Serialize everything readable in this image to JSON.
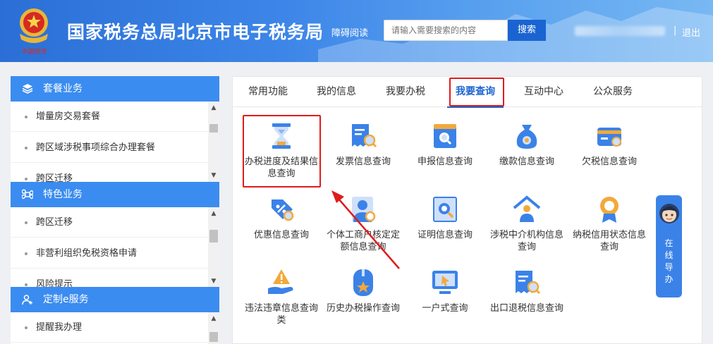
{
  "header": {
    "title": "国家税务总局北京市电子税务局",
    "a11y": "障碍阅读",
    "search_placeholder": "请输入需要搜索的内容",
    "search_button": "搜索",
    "separator": "|",
    "logout": "退出"
  },
  "sidebar": {
    "sections": [
      {
        "title": "套餐业务",
        "icon": "cube-stack-icon",
        "items": [
          "增量房交易套餐",
          "跨区域涉税事项综合办理套餐",
          "跨区迁移"
        ]
      },
      {
        "title": "特色业务",
        "icon": "command-icon",
        "items": [
          "跨区迁移",
          "非营利组织免税资格申请",
          "风险提示"
        ]
      },
      {
        "title": "定制e服务",
        "icon": "user-plus-icon",
        "items": [
          "提醒我办理"
        ]
      }
    ]
  },
  "tabs": [
    {
      "label": "常用功能",
      "active": false
    },
    {
      "label": "我的信息",
      "active": false
    },
    {
      "label": "我要办税",
      "active": false
    },
    {
      "label": "我要查询",
      "active": true
    },
    {
      "label": "互动中心",
      "active": false
    },
    {
      "label": "公众服务",
      "active": false
    }
  ],
  "grid": [
    {
      "label": "办税进度及结果信息查询",
      "icon": "hourglass-icon"
    },
    {
      "label": "发票信息查询",
      "icon": "invoice-search-icon"
    },
    {
      "label": "申报信息查询",
      "icon": "report-search-icon"
    },
    {
      "label": "缴款信息查询",
      "icon": "money-bag-icon"
    },
    {
      "label": "欠税信息查询",
      "icon": "wallet-icon"
    },
    {
      "label": "优惠信息查询",
      "icon": "discount-tag-icon"
    },
    {
      "label": "个体工商户核定定额信息查询",
      "icon": "person-icon"
    },
    {
      "label": "证明信息查询",
      "icon": "certificate-search-icon"
    },
    {
      "label": "涉税中介机构信息查询",
      "icon": "agency-house-icon"
    },
    {
      "label": "纳税信用状态信息查询",
      "icon": "credit-medal-icon"
    },
    {
      "label": "违法违章信息查询类",
      "icon": "warning-hand-icon"
    },
    {
      "label": "历史办税操作查询",
      "icon": "history-star-icon"
    },
    {
      "label": "一户式查询",
      "icon": "monitor-cursor-icon"
    },
    {
      "label": "出口退税信息查询",
      "icon": "export-refund-icon"
    }
  ],
  "guide": {
    "text": "在线导办"
  },
  "colors": {
    "accent": "#1a64d2",
    "sidebar_header": "#3b8cf0",
    "highlight": "#e01b1b"
  }
}
